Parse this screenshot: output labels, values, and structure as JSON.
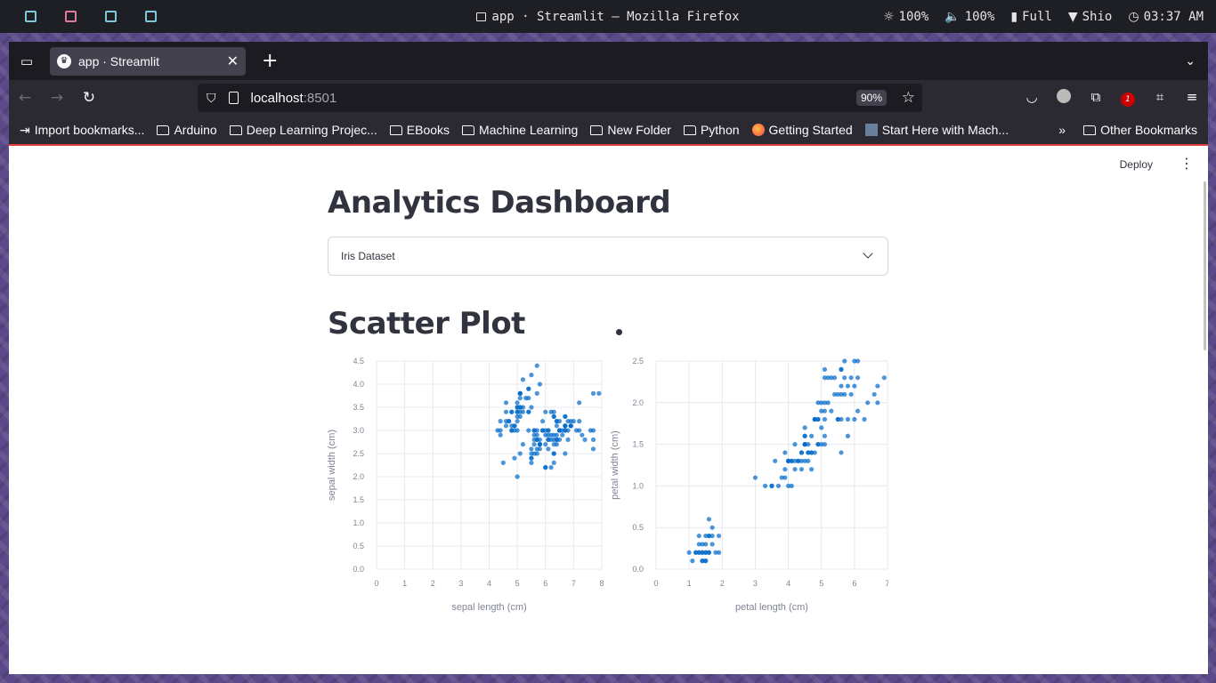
{
  "system_bar": {
    "window_title": "app · Streamlit — Mozilla Firefox",
    "brightness": "100%",
    "volume": "100%",
    "battery": "Full",
    "wifi": "Shio",
    "time": "03:37 AM"
  },
  "browser": {
    "tab_title": "app · Streamlit",
    "url_host": "localhost",
    "url_port": ":8501",
    "zoom": "90%",
    "extension_badge": "1",
    "bookmarks": [
      {
        "label": "Import bookmarks...",
        "icon": "import-icon"
      },
      {
        "label": "Arduino",
        "icon": "folder-icon"
      },
      {
        "label": "Deep Learning Projec...",
        "icon": "folder-icon"
      },
      {
        "label": "EBooks",
        "icon": "folder-icon"
      },
      {
        "label": "Machine Learning",
        "icon": "folder-icon"
      },
      {
        "label": "New Folder",
        "icon": "folder-icon"
      },
      {
        "label": "Python",
        "icon": "folder-icon"
      },
      {
        "label": "Getting Started",
        "icon": "firefox-icon"
      },
      {
        "label": "Start Here with Mach...",
        "icon": "image-icon"
      }
    ],
    "other_bookmarks": "Other Bookmarks"
  },
  "app": {
    "deploy_label": "Deploy",
    "title": "Analytics Dashboard",
    "dataset_select": "Iris Dataset",
    "section_title": "Scatter Plot"
  },
  "chart_data": [
    {
      "type": "scatter",
      "xlabel": "sepal length (cm)",
      "ylabel": "sepal width (cm)",
      "xlim": [
        0,
        8
      ],
      "ylim": [
        0,
        4.5
      ],
      "x_ticks": [
        0,
        1,
        2,
        3,
        4,
        5,
        6,
        7,
        8
      ],
      "y_ticks": [
        0.0,
        0.5,
        1.0,
        1.5,
        2.0,
        2.5,
        3.0,
        3.5,
        4.0,
        4.5
      ],
      "color": "#0068c9",
      "points": [
        [
          5.1,
          3.5
        ],
        [
          4.9,
          3.0
        ],
        [
          4.7,
          3.2
        ],
        [
          4.6,
          3.1
        ],
        [
          5.0,
          3.6
        ],
        [
          5.4,
          3.9
        ],
        [
          4.6,
          3.4
        ],
        [
          5.0,
          3.4
        ],
        [
          4.4,
          2.9
        ],
        [
          4.9,
          3.1
        ],
        [
          5.4,
          3.7
        ],
        [
          4.8,
          3.4
        ],
        [
          4.8,
          3.0
        ],
        [
          4.3,
          3.0
        ],
        [
          5.8,
          4.0
        ],
        [
          5.7,
          4.4
        ],
        [
          5.4,
          3.9
        ],
        [
          5.1,
          3.5
        ],
        [
          5.7,
          3.8
        ],
        [
          5.1,
          3.8
        ],
        [
          5.4,
          3.4
        ],
        [
          5.1,
          3.7
        ],
        [
          4.6,
          3.6
        ],
        [
          5.1,
          3.3
        ],
        [
          4.8,
          3.4
        ],
        [
          5.0,
          3.0
        ],
        [
          5.0,
          3.4
        ],
        [
          5.2,
          3.5
        ],
        [
          5.2,
          3.4
        ],
        [
          4.7,
          3.2
        ],
        [
          4.8,
          3.1
        ],
        [
          5.4,
          3.4
        ],
        [
          5.2,
          4.1
        ],
        [
          5.5,
          4.2
        ],
        [
          4.9,
          3.1
        ],
        [
          5.0,
          3.2
        ],
        [
          5.5,
          3.5
        ],
        [
          4.4,
          3.0
        ],
        [
          5.1,
          3.4
        ],
        [
          5.0,
          3.5
        ],
        [
          4.5,
          2.3
        ],
        [
          4.4,
          3.2
        ],
        [
          5.0,
          3.5
        ],
        [
          5.1,
          3.8
        ],
        [
          4.8,
          3.0
        ],
        [
          5.1,
          3.8
        ],
        [
          4.6,
          3.2
        ],
        [
          5.3,
          3.7
        ],
        [
          5.0,
          3.3
        ],
        [
          7.0,
          3.2
        ],
        [
          6.4,
          3.2
        ],
        [
          6.9,
          3.1
        ],
        [
          5.5,
          2.3
        ],
        [
          6.5,
          2.8
        ],
        [
          5.7,
          2.8
        ],
        [
          6.3,
          3.3
        ],
        [
          4.9,
          2.4
        ],
        [
          6.6,
          2.9
        ],
        [
          5.2,
          2.7
        ],
        [
          5.0,
          2.0
        ],
        [
          5.9,
          3.0
        ],
        [
          6.0,
          2.2
        ],
        [
          6.1,
          2.9
        ],
        [
          5.6,
          2.9
        ],
        [
          6.7,
          3.1
        ],
        [
          5.6,
          3.0
        ],
        [
          5.8,
          2.7
        ],
        [
          6.2,
          2.2
        ],
        [
          5.6,
          2.5
        ],
        [
          5.9,
          3.2
        ],
        [
          6.1,
          2.8
        ],
        [
          6.3,
          2.5
        ],
        [
          6.1,
          2.8
        ],
        [
          6.4,
          2.9
        ],
        [
          6.6,
          3.0
        ],
        [
          6.8,
          2.8
        ],
        [
          6.7,
          3.0
        ],
        [
          6.0,
          2.9
        ],
        [
          5.7,
          2.6
        ],
        [
          5.5,
          2.4
        ],
        [
          5.5,
          2.4
        ],
        [
          5.8,
          2.7
        ],
        [
          6.0,
          2.7
        ],
        [
          5.4,
          3.0
        ],
        [
          6.0,
          3.4
        ],
        [
          6.7,
          3.1
        ],
        [
          6.3,
          2.3
        ],
        [
          5.6,
          3.0
        ],
        [
          5.5,
          2.5
        ],
        [
          5.5,
          2.6
        ],
        [
          6.1,
          3.0
        ],
        [
          5.8,
          2.6
        ],
        [
          5.6,
          2.7
        ],
        [
          5.7,
          3.0
        ],
        [
          5.7,
          2.9
        ],
        [
          6.2,
          2.9
        ],
        [
          5.1,
          2.5
        ],
        [
          5.7,
          2.8
        ],
        [
          6.3,
          3.3
        ],
        [
          5.8,
          2.7
        ],
        [
          7.1,
          3.0
        ],
        [
          6.3,
          2.9
        ],
        [
          6.5,
          3.0
        ],
        [
          7.6,
          3.0
        ],
        [
          7.3,
          2.9
        ],
        [
          6.7,
          2.5
        ],
        [
          7.2,
          3.6
        ],
        [
          6.5,
          3.2
        ],
        [
          6.4,
          2.7
        ],
        [
          6.8,
          3.0
        ],
        [
          5.7,
          2.5
        ],
        [
          5.8,
          2.8
        ],
        [
          6.4,
          3.2
        ],
        [
          6.5,
          3.0
        ],
        [
          7.7,
          3.8
        ],
        [
          7.7,
          2.6
        ],
        [
          6.0,
          2.2
        ],
        [
          6.9,
          3.2
        ],
        [
          5.6,
          2.8
        ],
        [
          7.7,
          2.8
        ],
        [
          6.3,
          2.7
        ],
        [
          6.7,
          3.3
        ],
        [
          7.2,
          3.2
        ],
        [
          6.2,
          2.8
        ],
        [
          6.1,
          3.0
        ],
        [
          6.4,
          2.8
        ],
        [
          7.2,
          3.0
        ],
        [
          7.4,
          2.8
        ],
        [
          7.9,
          3.8
        ],
        [
          6.4,
          2.8
        ],
        [
          6.3,
          2.8
        ],
        [
          6.1,
          2.6
        ],
        [
          7.7,
          3.0
        ],
        [
          6.3,
          3.4
        ],
        [
          6.4,
          3.1
        ],
        [
          6.0,
          3.0
        ],
        [
          6.9,
          3.1
        ],
        [
          6.7,
          3.1
        ],
        [
          6.9,
          3.1
        ],
        [
          6.8,
          3.2
        ],
        [
          6.7,
          3.3
        ],
        [
          6.7,
          3.0
        ],
        [
          6.3,
          2.5
        ],
        [
          6.5,
          3.0
        ],
        [
          6.2,
          3.4
        ],
        [
          5.9,
          3.0
        ]
      ]
    },
    {
      "type": "scatter",
      "xlabel": "petal length (cm)",
      "ylabel": "petal width (cm)",
      "xlim": [
        0,
        7
      ],
      "ylim": [
        0,
        2.5
      ],
      "x_ticks": [
        0,
        1,
        2,
        3,
        4,
        5,
        6,
        7
      ],
      "y_ticks": [
        0.0,
        0.5,
        1.0,
        1.5,
        2.0,
        2.5
      ],
      "color": "#0068c9",
      "points": [
        [
          1.4,
          0.2
        ],
        [
          1.3,
          0.2
        ],
        [
          1.5,
          0.2
        ],
        [
          1.7,
          0.4
        ],
        [
          1.4,
          0.3
        ],
        [
          1.5,
          0.1
        ],
        [
          1.1,
          0.1
        ],
        [
          1.2,
          0.2
        ],
        [
          1.3,
          0.4
        ],
        [
          1.4,
          0.1
        ],
        [
          1.7,
          0.3
        ],
        [
          1.0,
          0.2
        ],
        [
          1.9,
          0.4
        ],
        [
          1.6,
          0.2
        ],
        [
          1.6,
          0.4
        ],
        [
          1.5,
          0.4
        ],
        [
          1.4,
          0.2
        ],
        [
          1.6,
          0.6
        ],
        [
          1.9,
          0.2
        ],
        [
          1.5,
          0.3
        ],
        [
          1.2,
          0.2
        ],
        [
          1.3,
          0.3
        ],
        [
          1.6,
          0.2
        ],
        [
          1.7,
          0.5
        ],
        [
          1.5,
          0.2
        ],
        [
          1.3,
          0.2
        ],
        [
          1.4,
          0.1
        ],
        [
          1.6,
          0.4
        ],
        [
          1.5,
          0.1
        ],
        [
          1.8,
          0.2
        ],
        [
          4.7,
          1.4
        ],
        [
          4.5,
          1.5
        ],
        [
          4.9,
          1.5
        ],
        [
          4.0,
          1.3
        ],
        [
          4.6,
          1.5
        ],
        [
          4.5,
          1.3
        ],
        [
          3.3,
          1.0
        ],
        [
          4.6,
          1.3
        ],
        [
          3.9,
          1.4
        ],
        [
          3.5,
          1.0
        ],
        [
          4.2,
          1.5
        ],
        [
          4.0,
          1.0
        ],
        [
          4.7,
          1.4
        ],
        [
          3.6,
          1.3
        ],
        [
          4.4,
          1.4
        ],
        [
          4.5,
          1.5
        ],
        [
          4.1,
          1.0
        ],
        [
          4.5,
          1.5
        ],
        [
          3.9,
          1.1
        ],
        [
          4.8,
          1.8
        ],
        [
          4.0,
          1.3
        ],
        [
          4.9,
          1.5
        ],
        [
          4.7,
          1.2
        ],
        [
          4.3,
          1.3
        ],
        [
          4.4,
          1.4
        ],
        [
          4.8,
          1.4
        ],
        [
          5.0,
          1.7
        ],
        [
          3.8,
          1.1
        ],
        [
          3.7,
          1.0
        ],
        [
          3.9,
          1.2
        ],
        [
          5.1,
          1.6
        ],
        [
          4.5,
          1.6
        ],
        [
          4.4,
          1.3
        ],
        [
          4.1,
          1.3
        ],
        [
          4.0,
          1.3
        ],
        [
          4.4,
          1.2
        ],
        [
          4.6,
          1.4
        ],
        [
          3.0,
          1.1
        ],
        [
          4.2,
          1.3
        ],
        [
          4.2,
          1.2
        ],
        [
          4.3,
          1.3
        ],
        [
          3.5,
          1.0
        ],
        [
          4.1,
          1.3
        ],
        [
          6.0,
          2.5
        ],
        [
          5.1,
          1.9
        ],
        [
          5.9,
          2.1
        ],
        [
          5.6,
          1.8
        ],
        [
          5.8,
          2.2
        ],
        [
          6.6,
          2.1
        ],
        [
          4.5,
          1.7
        ],
        [
          6.3,
          1.8
        ],
        [
          6.1,
          2.5
        ],
        [
          5.1,
          2.0
        ],
        [
          5.3,
          1.9
        ],
        [
          5.5,
          2.1
        ],
        [
          5.0,
          2.0
        ],
        [
          5.1,
          2.4
        ],
        [
          5.3,
          2.3
        ],
        [
          5.5,
          1.8
        ],
        [
          6.7,
          2.2
        ],
        [
          6.9,
          2.3
        ],
        [
          5.0,
          1.5
        ],
        [
          5.7,
          2.3
        ],
        [
          4.9,
          2.0
        ],
        [
          6.7,
          2.0
        ],
        [
          4.9,
          1.8
        ],
        [
          5.7,
          2.1
        ],
        [
          6.0,
          1.8
        ],
        [
          4.8,
          1.8
        ],
        [
          4.9,
          1.8
        ],
        [
          5.6,
          2.1
        ],
        [
          5.8,
          1.6
        ],
        [
          6.1,
          1.9
        ],
        [
          6.4,
          2.0
        ],
        [
          5.6,
          2.2
        ],
        [
          5.1,
          1.5
        ],
        [
          5.6,
          1.4
        ],
        [
          6.1,
          2.3
        ],
        [
          5.6,
          2.4
        ],
        [
          5.5,
          1.8
        ],
        [
          4.8,
          1.8
        ],
        [
          5.4,
          2.1
        ],
        [
          5.6,
          2.4
        ],
        [
          5.1,
          2.3
        ],
        [
          5.9,
          2.3
        ],
        [
          5.7,
          2.5
        ],
        [
          5.2,
          2.3
        ],
        [
          5.0,
          1.9
        ],
        [
          5.2,
          2.0
        ],
        [
          5.4,
          2.3
        ],
        [
          5.1,
          1.8
        ],
        [
          5.8,
          1.8
        ],
        [
          6.0,
          2.2
        ],
        [
          4.7,
          1.6
        ],
        [
          4.6,
          1.4
        ],
        [
          4.5,
          1.6
        ]
      ]
    }
  ]
}
